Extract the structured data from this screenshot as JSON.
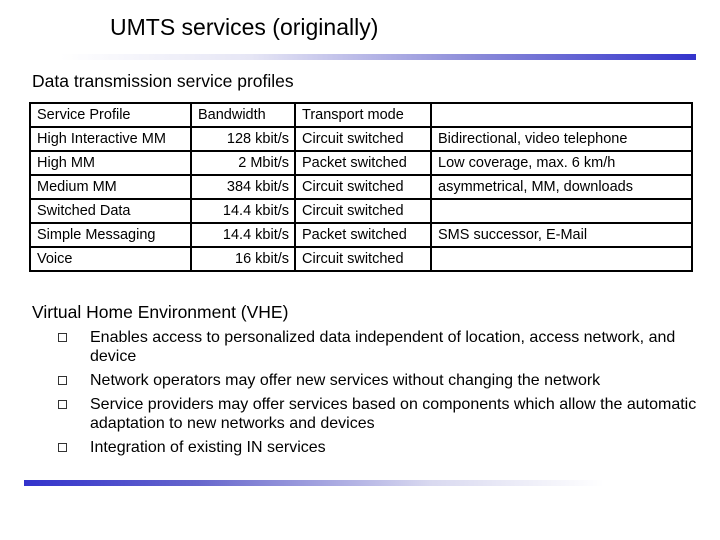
{
  "slide": {
    "title": "UMTS services (originally)",
    "accent_color": "#3333cc"
  },
  "section1": {
    "heading": "Data transmission service profiles",
    "table": {
      "header": [
        "Service Profile",
        "Bandwidth",
        "Transport mode",
        ""
      ],
      "rows": [
        [
          "High Interactive MM",
          "128 kbit/s",
          "Circuit switched",
          "Bidirectional, video telephone"
        ],
        [
          "High MM",
          "2 Mbit/s",
          "Packet switched",
          "Low coverage, max. 6 km/h"
        ],
        [
          "Medium MM",
          "384 kbit/s",
          "Circuit switched",
          "asymmetrical, MM, downloads"
        ],
        [
          "Switched Data",
          "14.4 kbit/s",
          "Circuit switched",
          ""
        ],
        [
          "Simple Messaging",
          "14.4 kbit/s",
          "Packet switched",
          "SMS successor, E-Mail"
        ],
        [
          "Voice",
          "16 kbit/s",
          "Circuit switched",
          ""
        ]
      ]
    }
  },
  "section2": {
    "heading": "Virtual Home Environment (VHE)",
    "bullet_icon": "hollow-square-bullet",
    "bullets": [
      "Enables access to personalized data independent of location, access network, and device",
      "Network operators may offer new services without changing the network",
      "Service providers may offer services based on components which allow the automatic adaptation to new networks and devices",
      "Integration of existing IN services"
    ]
  }
}
